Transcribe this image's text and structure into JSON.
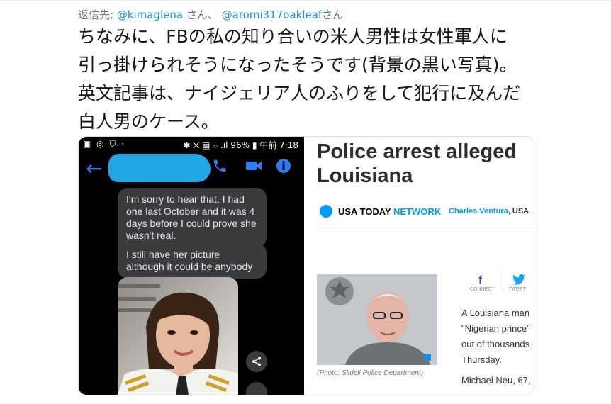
{
  "reply": {
    "prefix": "返信先: ",
    "mentions": [
      "@kimaglena",
      "@aromi317oakleaf"
    ],
    "san1": " さん、 ",
    "san2": "さん"
  },
  "tweet": {
    "lines": [
      "ちなみに、FBの私の知り合いの米人男性は女性軍人に",
      "引っ掛けられそうになったそうです(背景の黒い写真)。",
      "英文記事は、ナイジェリア人のふりをして犯行に及んだ",
      "白人男のケース。"
    ]
  },
  "phone": {
    "status_left": "▣ ◎ ⛉ ·",
    "status_right": "✱ ⛌ ▤ ⌔ .ıl 96% ▮ 午前 7:18",
    "messages": [
      "I'm sorry to hear that. I had one last October and it was 4 days before I could prove she wasn't real.",
      "I still have her picture although it could be anybody"
    ]
  },
  "article": {
    "headline_1": "Police arrest alleged",
    "headline_2": "Louisiana",
    "brand_a": "USA TODAY ",
    "brand_b": "NETWORK",
    "author": "Charles Ventura",
    "author_suffix": ", USA",
    "caption": "(Photo: Slidell Police Department)",
    "connect": "CONNECT",
    "tweet_label": "TWEET",
    "body_lines": [
      "A Louisiana man",
      "\"Nigerian prince\"",
      "out of thousands",
      "Thursday."
    ],
    "body_last": "Michael Neu, 67,"
  },
  "colors": {
    "mention": "#1b95e0",
    "messenger_blue": "#2c7cf6",
    "usa_today_blue": "#009bff"
  },
  "icons": [
    "back-arrow-icon",
    "phone-icon",
    "video-icon",
    "info-icon",
    "share-icon",
    "facebook-icon",
    "twitter-icon"
  ]
}
